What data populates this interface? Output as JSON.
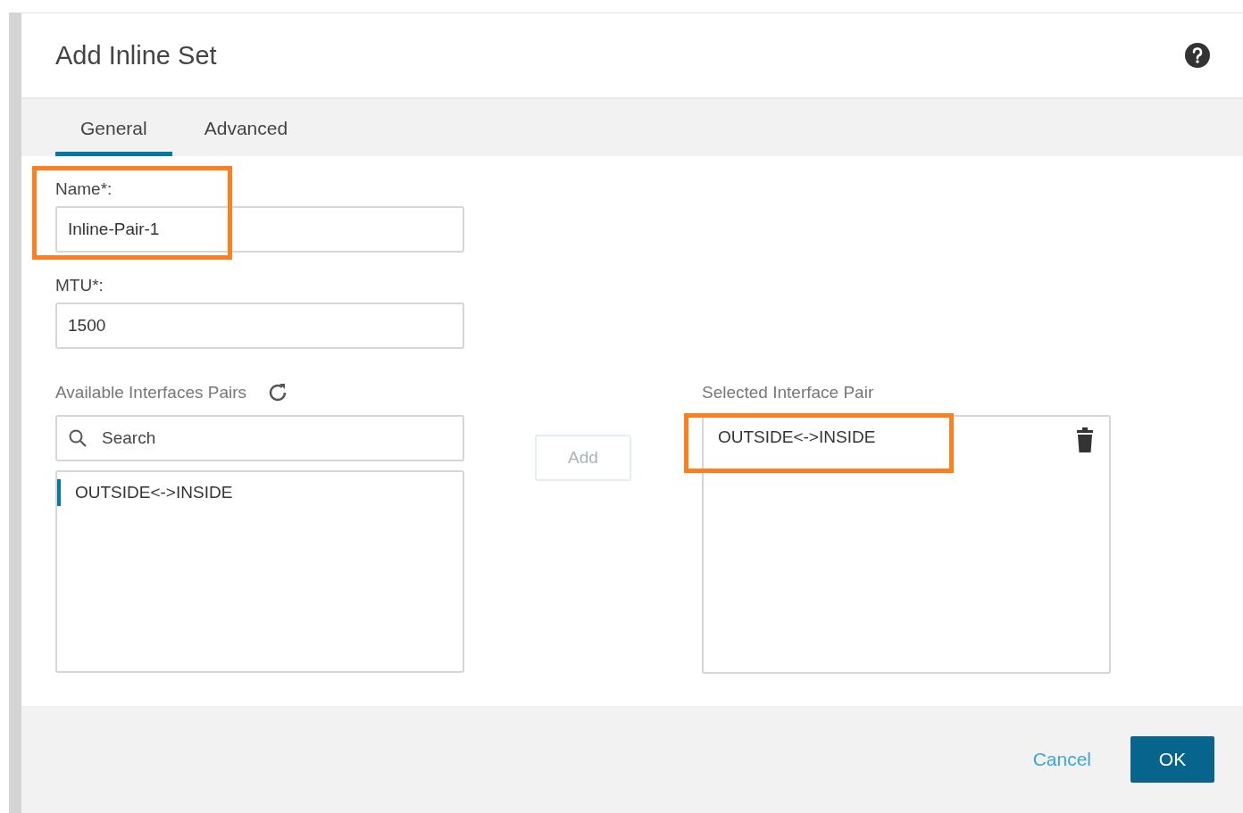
{
  "dialog": {
    "title": "Add Inline Set"
  },
  "tabs": [
    {
      "label": "General",
      "selected": true
    },
    {
      "label": "Advanced",
      "selected": false
    }
  ],
  "name_field": {
    "label": "Name*:",
    "value": "Inline-Pair-1",
    "highlighted": true
  },
  "mtu_field": {
    "label": "MTU*:",
    "value": "1500"
  },
  "available": {
    "label": "Available Interfaces Pairs",
    "search": {
      "placeholder": "Search"
    },
    "items": [
      {
        "label": "OUTSIDE<->INSIDE",
        "selected": true
      }
    ]
  },
  "add_button": {
    "label": "Add",
    "disabled": true
  },
  "selected_pairs": {
    "label": "Selected Interface Pair",
    "items": [
      {
        "label": "OUTSIDE<->INSIDE",
        "highlighted": true
      }
    ]
  },
  "footer": {
    "cancel": "Cancel",
    "ok": "OK"
  }
}
